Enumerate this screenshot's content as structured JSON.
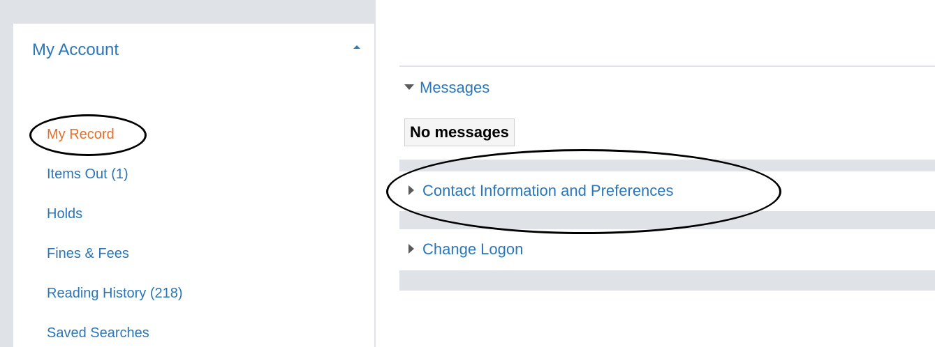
{
  "sidebar": {
    "title": "My Account",
    "items": [
      {
        "label": "My Record",
        "active": true
      },
      {
        "label": "Items Out (1)",
        "active": false
      },
      {
        "label": "Holds",
        "active": false
      },
      {
        "label": "Fines & Fees",
        "active": false
      },
      {
        "label": "Reading History (218)",
        "active": false
      },
      {
        "label": "Saved Searches",
        "active": false
      }
    ]
  },
  "main": {
    "sections": [
      {
        "label": "Messages",
        "expanded": true,
        "content": "No messages"
      },
      {
        "label": "Contact Information and Preferences",
        "expanded": false
      },
      {
        "label": "Change Logon",
        "expanded": false
      }
    ]
  },
  "colors": {
    "link": "#2a76b9",
    "active": "#e46f29",
    "panel_gray": "#dfe3e8",
    "annotation": "#000000"
  },
  "icons": {
    "collapse": "caret-up-icon",
    "expanded": "triangle-down-icon",
    "collapsed": "triangle-right-icon"
  }
}
